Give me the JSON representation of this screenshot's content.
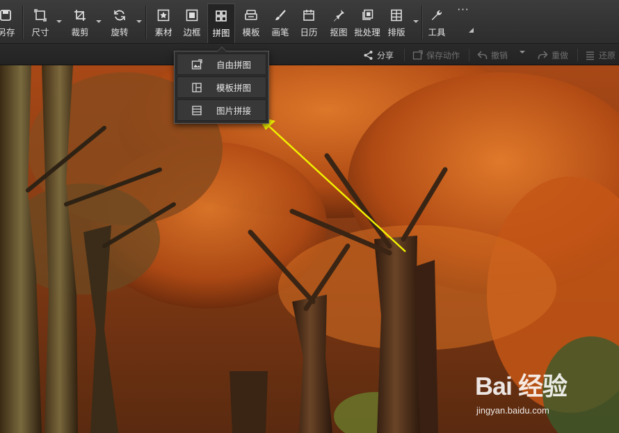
{
  "toolbar": {
    "items": [
      {
        "label": "另存",
        "icon": "save-as-icon"
      },
      {
        "label": "尺寸",
        "icon": "resize-icon"
      },
      {
        "label": "裁剪",
        "icon": "crop-icon"
      },
      {
        "label": "旋转",
        "icon": "rotate-icon"
      },
      {
        "label": "素材",
        "icon": "stickers-icon"
      },
      {
        "label": "边框",
        "icon": "border-icon"
      },
      {
        "label": "拼图",
        "icon": "collage-icon",
        "active": true
      },
      {
        "label": "模板",
        "icon": "template-icon"
      },
      {
        "label": "画笔",
        "icon": "brush-icon"
      },
      {
        "label": "日历",
        "icon": "calendar-icon"
      },
      {
        "label": "抠图",
        "icon": "cutout-icon"
      },
      {
        "label": "批处理",
        "icon": "batch-icon"
      },
      {
        "label": "排版",
        "icon": "layout-icon"
      },
      {
        "label": "工具",
        "icon": "wrench-icon"
      },
      {
        "label": "···",
        "icon": "more-icon"
      }
    ]
  },
  "actions": {
    "share": "分享",
    "save_action": "保存动作",
    "undo": "撤销",
    "redo": "重做",
    "restore": "还原"
  },
  "collage_menu": {
    "items": [
      {
        "label": "自由拼图",
        "icon": "free-collage-icon"
      },
      {
        "label": "模板拼图",
        "icon": "template-collage-icon"
      },
      {
        "label": "图片拼接",
        "icon": "stitch-icon"
      }
    ]
  },
  "watermark": {
    "brand": "Bai 经验",
    "url": "jingyan.baidu.com"
  },
  "colors": {
    "toolbar_bg": "#333333",
    "annotation_arrow": "#f2f200",
    "foliage": "#c65a18",
    "trunk": "#4a2a16"
  }
}
